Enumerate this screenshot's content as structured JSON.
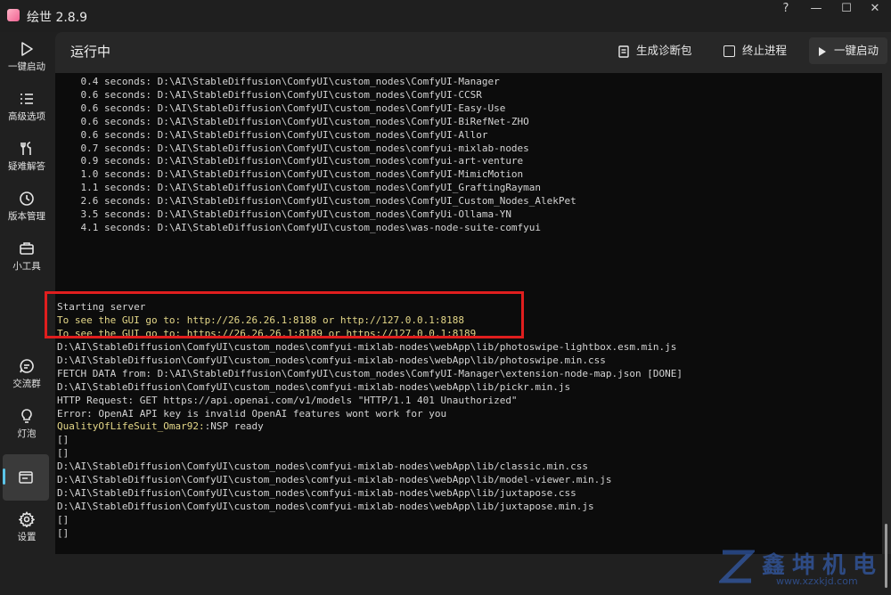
{
  "window": {
    "title": "绘世 2.8.9",
    "controls": [
      "?",
      "—",
      "☐",
      "✕"
    ]
  },
  "sidebar": {
    "items": [
      {
        "label": "一键启动",
        "icon": "play-icon"
      },
      {
        "label": "高级选项",
        "icon": "list-icon"
      },
      {
        "label": "疑难解答",
        "icon": "tools-icon"
      },
      {
        "label": "版本管理",
        "icon": "history-icon"
      },
      {
        "label": "小工具",
        "icon": "toolbox-icon"
      },
      {
        "label": "交流群",
        "icon": "chat-icon"
      },
      {
        "label": "灯泡",
        "icon": "lightbulb-icon"
      },
      {
        "label": "",
        "icon": "console-icon",
        "active": true
      },
      {
        "label": "设置",
        "icon": "gear-icon"
      }
    ]
  },
  "header": {
    "title": "运行中",
    "diagnostics_label": "生成诊断包",
    "terminate_label": "终止进程",
    "launch_label": "一键启动"
  },
  "console": {
    "lines": [
      "    0.4 seconds: D:\\AI\\StableDiffusion\\ComfyUI\\custom_nodes\\ComfyUI-Manager",
      "    0.6 seconds: D:\\AI\\StableDiffusion\\ComfyUI\\custom_nodes\\ComfyUI-CCSR",
      "    0.6 seconds: D:\\AI\\StableDiffusion\\ComfyUI\\custom_nodes\\ComfyUI-Easy-Use",
      "    0.6 seconds: D:\\AI\\StableDiffusion\\ComfyUI\\custom_nodes\\ComfyUI-BiRefNet-ZHO",
      "    0.6 seconds: D:\\AI\\StableDiffusion\\ComfyUI\\custom_nodes\\ComfyUI-Allor",
      "    0.7 seconds: D:\\AI\\StableDiffusion\\ComfyUI\\custom_nodes\\comfyui-mixlab-nodes",
      "    0.9 seconds: D:\\AI\\StableDiffusion\\ComfyUI\\custom_nodes\\comfyui-art-venture",
      "    1.0 seconds: D:\\AI\\StableDiffusion\\ComfyUI\\custom_nodes\\ComfyUI-MimicMotion",
      "    1.1 seconds: D:\\AI\\StableDiffusion\\ComfyUI\\custom_nodes\\ComfyUI_GraftingRayman",
      "    2.6 seconds: D:\\AI\\StableDiffusion\\ComfyUI\\custom_nodes\\ComfyUI_Custom_Nodes_AlekPet",
      "    3.5 seconds: D:\\AI\\StableDiffusion\\ComfyUI\\custom_nodes\\ComfyUi-Ollama-YN",
      "    4.1 seconds: D:\\AI\\StableDiffusion\\ComfyUI\\custom_nodes\\was-node-suite-comfyui",
      "",
      "",
      "",
      "",
      "",
      "Starting server",
      "To see the GUI go to: http://26.26.26.1:8188 or http://127.0.0.1:8188",
      "To see the GUI go to: https://26.26.26.1:8189 or https://127.0.0.1:8189",
      "D:\\AI\\StableDiffusion\\ComfyUI\\custom_nodes\\comfyui-mixlab-nodes\\webApp\\lib/photoswipe-lightbox.esm.min.js",
      "D:\\AI\\StableDiffusion\\ComfyUI\\custom_nodes\\comfyui-mixlab-nodes\\webApp\\lib/photoswipe.min.css",
      "FETCH DATA from: D:\\AI\\StableDiffusion\\ComfyUI\\custom_nodes\\ComfyUI-Manager\\extension-node-map.json [DONE]",
      "D:\\AI\\StableDiffusion\\ComfyUI\\custom_nodes\\comfyui-mixlab-nodes\\webApp\\lib/pickr.min.js",
      "HTTP Request: GET https://api.openai.com/v1/models \"HTTP/1.1 401 Unauthorized\"",
      "Error: OpenAI API key is invalid OpenAI features wont work for you",
      "",
      "[]",
      "[]",
      "D:\\AI\\StableDiffusion\\ComfyUI\\custom_nodes\\comfyui-mixlab-nodes\\webApp\\lib/classic.min.css",
      "D:\\AI\\StableDiffusion\\ComfyUI\\custom_nodes\\comfyui-mixlab-nodes\\webApp\\lib/model-viewer.min.js",
      "D:\\AI\\StableDiffusion\\ComfyUI\\custom_nodes\\comfyui-mixlab-nodes\\webApp\\lib/juxtapose.css",
      "D:\\AI\\StableDiffusion\\ComfyUI\\custom_nodes\\comfyui-mixlab-nodes\\webApp\\lib/juxtapose.min.js",
      "[]",
      "[]"
    ],
    "qol_prefix": "QualityOfLifeSuit_Omar92:",
    "qol_suffix": ":NSP ready"
  },
  "watermark": {
    "name": "鑫坤机电",
    "url": "www.xzxkjd.com"
  },
  "colors": {
    "accent": "#5bc4e8",
    "highlight_box": "#e01e1e",
    "yellow_text": "#e5d889",
    "console_bg": "#0c0c0c"
  }
}
